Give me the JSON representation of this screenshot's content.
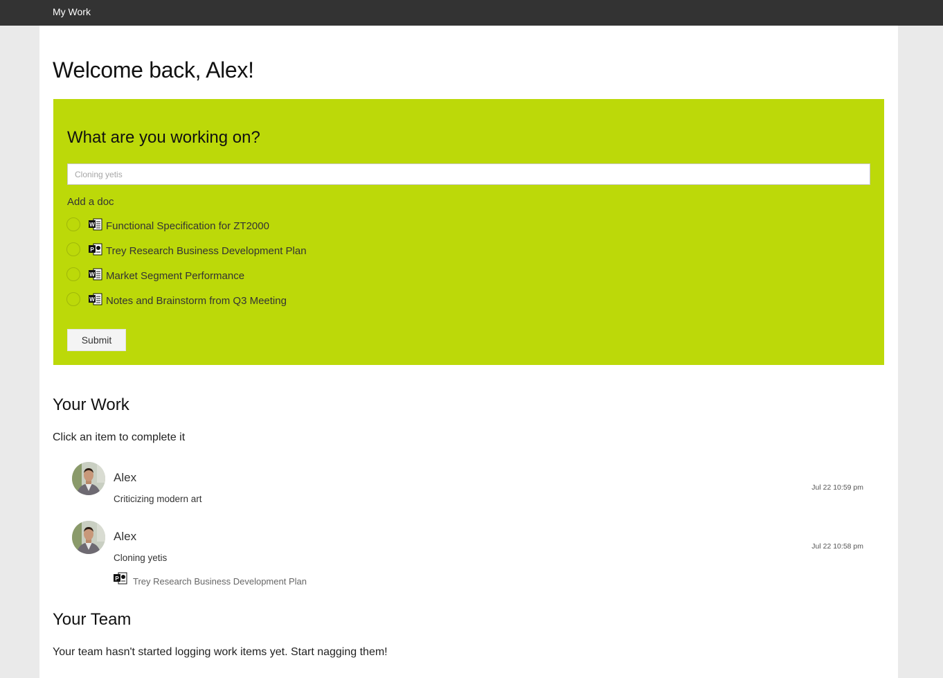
{
  "topbar": {
    "brand": "My Work"
  },
  "welcome": "Welcome back, Alex!",
  "panel": {
    "heading": "What are you working on?",
    "input_placeholder": "Cloning yetis",
    "input_value": "",
    "add_doc_label": "Add a doc",
    "docs": [
      {
        "title": "Functional Specification for ZT2000",
        "icon": "word-doc-icon",
        "selected": false
      },
      {
        "title": "Trey Research Business Development Plan",
        "icon": "powerpoint-doc-icon",
        "selected": false
      },
      {
        "title": "Market Segment Performance",
        "icon": "word-doc-icon",
        "selected": false
      },
      {
        "title": "Notes and Brainstorm from Q3 Meeting",
        "icon": "word-doc-icon",
        "selected": false
      }
    ],
    "submit_label": "Submit",
    "accent_color": "#bcd909"
  },
  "your_work": {
    "title": "Your Work",
    "subtitle": "Click an item to complete it",
    "items": [
      {
        "author": "Alex",
        "description": "Criticizing modern art",
        "time": "Jul 22 10:59 pm"
      },
      {
        "author": "Alex",
        "description": "Cloning yetis",
        "time": "Jul 22 10:58 pm",
        "attachment": {
          "title": "Trey Research Business Development Plan",
          "icon": "powerpoint-doc-icon"
        }
      }
    ]
  },
  "your_team": {
    "title": "Your Team",
    "message": "Your team hasn't started logging work items yet. Start nagging them!"
  }
}
